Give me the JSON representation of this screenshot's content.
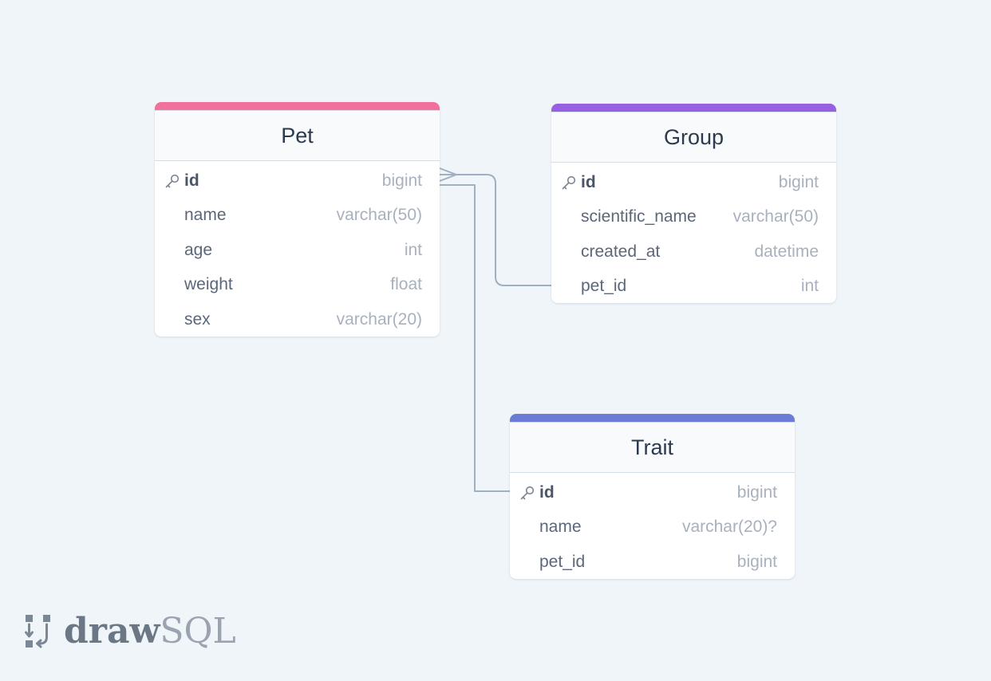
{
  "colors": {
    "background": "#f0f5f9",
    "connector": "#9fb0c3",
    "pet_accent": "#f2709c",
    "group_accent": "#9660e0",
    "trait_accent": "#6b7bd6"
  },
  "tables": {
    "pet": {
      "name": "Pet",
      "columns": [
        {
          "name": "id",
          "type": "bigint",
          "primary_key": true
        },
        {
          "name": "name",
          "type": "varchar(50)",
          "primary_key": false
        },
        {
          "name": "age",
          "type": "int",
          "primary_key": false
        },
        {
          "name": "weight",
          "type": "float",
          "primary_key": false
        },
        {
          "name": "sex",
          "type": "varchar(20)",
          "primary_key": false
        }
      ]
    },
    "group": {
      "name": "Group",
      "columns": [
        {
          "name": "id",
          "type": "bigint",
          "primary_key": true
        },
        {
          "name": "scientific_name",
          "type": "varchar(50)",
          "primary_key": false
        },
        {
          "name": "created_at",
          "type": "datetime",
          "primary_key": false
        },
        {
          "name": "pet_id",
          "type": "int",
          "primary_key": false
        }
      ]
    },
    "trait": {
      "name": "Trait",
      "columns": [
        {
          "name": "id",
          "type": "bigint",
          "primary_key": true
        },
        {
          "name": "name",
          "type": "varchar(20)?",
          "primary_key": false
        },
        {
          "name": "pet_id",
          "type": "bigint",
          "primary_key": false
        }
      ]
    }
  },
  "relationships": [
    {
      "from": "Pet.id",
      "to": "Group.pet_id",
      "cardinality": "one-to-many"
    },
    {
      "from": "Pet.id",
      "to": "Trait.id",
      "cardinality": "one-to-one"
    }
  ],
  "logo": {
    "draw": "draw",
    "sql": "SQL"
  }
}
